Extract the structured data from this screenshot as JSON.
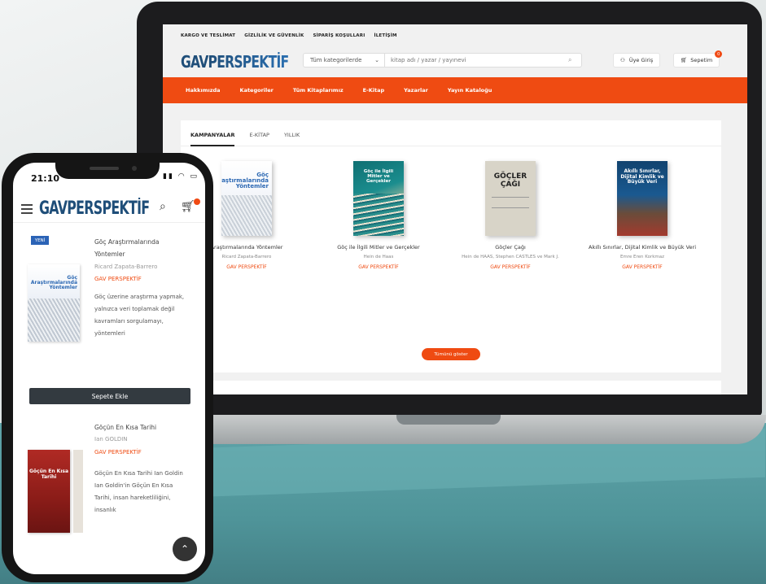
{
  "laptop": {
    "topnav": [
      "KARGO VE TESLİMAT",
      "GİZLİLİK VE GÜVENLİK",
      "SİPARİŞ KOŞULLARI",
      "İLETİŞİM"
    ],
    "logo": {
      "part1": "GAV",
      "part2": "PERSPEKTİF"
    },
    "search": {
      "category": "Tüm kategorilerde",
      "placeholder": "kitap adı / yazar / yayınevi"
    },
    "account_label": "Üye Giriş",
    "cart_label": "Sepetim",
    "cart_count": "0",
    "menu": [
      "Hakkımızda",
      "Kategoriler",
      "Tüm Kitaplarımız",
      "E-Kitap",
      "Yazarlar",
      "Yayın Kataloğu"
    ],
    "tabs": [
      "KAMPANYALAR",
      "E-KİTAP",
      "YILLIK"
    ],
    "books": [
      {
        "cover_title": "Göç Araştırmalarında Yöntemler",
        "title": "Araştırmalarında Yöntemler",
        "author": "Ricard Zapata-Barrero",
        "publisher": "GAV PERSPEKTİF"
      },
      {
        "cover_title": "Göç ile İlgili Mitler ve Gerçekler",
        "title": "Göç ile İlgili Mitler ve Gerçekler",
        "author": "Hein de Haas",
        "publisher": "GAV PERSPEKTİF"
      },
      {
        "cover_title": "GÖÇLER ÇAĞI",
        "title": "Göçler Çağı",
        "author": "Hein de HAAS, Stephen CASTLES ve Mark J.",
        "publisher": "GAV PERSPEKTİF"
      },
      {
        "cover_title": "Akıllı Sınırlar, Dijital Kimlik ve Büyük Veri",
        "title": "Akıllı Sınırlar, Dijital Kimlik ve Büyük Veri",
        "author": "Emre Eren Korkmaz",
        "publisher": "GAV PERSPEKTİF"
      }
    ],
    "show_all_label": "Tümünü göster"
  },
  "phone": {
    "time": "21:10",
    "status": "▮▮ ◠ ▭",
    "logo": "GAVPERSPEKTİF",
    "item1": {
      "tag": "YENİ",
      "cover_title": "Göç Araştırmalarında Yöntemler",
      "title_line1": "Göç Araştırmalarında",
      "title_line2": "Yöntemler",
      "author": "Ricard Zapata-Barrero",
      "publisher": "GAV PERSPEKTİF",
      "desc": "Göç üzerine araştırma yapmak, yalnızca veri toplamak değil kavramları sorgulamayı, yöntemleri"
    },
    "add_to_cart": "Sepete Ekle",
    "item2": {
      "cover_title": "Göçün En Kısa Tarihi",
      "title": "Göçün En Kısa Tarihi",
      "author": "Ian GOLDIN",
      "publisher": "GAV PERSPEKTİF",
      "desc": "Göçün En Kısa Tarihi Ian Goldin Ian Goldin'in Göçün En Kısa Tarihi, insan hareketliliğini, insanlık"
    }
  },
  "colors": {
    "brand_orange": "#ef4b12",
    "brand_blue": "#1f4e79",
    "teal": "#5fa4a9"
  },
  "icons": [
    "user-icon",
    "cart-icon",
    "search-icon",
    "menu-icon",
    "chevron-up-icon"
  ]
}
